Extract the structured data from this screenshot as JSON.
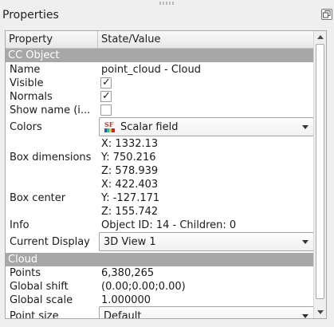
{
  "panel_title": "Properties",
  "columns": {
    "property": "Property",
    "value": "State/Value"
  },
  "sections": {
    "cc_object": "CC Object",
    "cloud": "Cloud"
  },
  "rows": {
    "name": {
      "label": "Name",
      "value": "point_cloud - Cloud"
    },
    "visible": {
      "label": "Visible",
      "checked": true
    },
    "normals": {
      "label": "Normals",
      "checked": true
    },
    "show_name": {
      "label": "Show name (i...",
      "checked": false
    },
    "colors": {
      "label": "Colors",
      "value": "Scalar field",
      "icon": "scalar-field-icon"
    },
    "box_dimensions": {
      "label": "Box dimensions",
      "x": "X: 1332.13",
      "y": "Y: 750.216",
      "z": "Z: 578.939"
    },
    "box_center": {
      "label": "Box center",
      "x": "X: 422.403",
      "y": "Y: -127.171",
      "z": "Z: 155.742"
    },
    "info": {
      "label": "Info",
      "value": "Object ID: 14 - Children: 0"
    },
    "current_display": {
      "label": "Current Display",
      "value": "3D View 1"
    },
    "points": {
      "label": "Points",
      "value": "6,380,265"
    },
    "global_shift": {
      "label": "Global shift",
      "value": "(0.00;0.00;0.00)"
    },
    "global_scale": {
      "label": "Global scale",
      "value": "1.000000"
    },
    "point_size": {
      "label": "Point size",
      "value": "Default"
    }
  },
  "check_mark": "✓",
  "scrollbar": {
    "position_fraction": 0.0
  }
}
